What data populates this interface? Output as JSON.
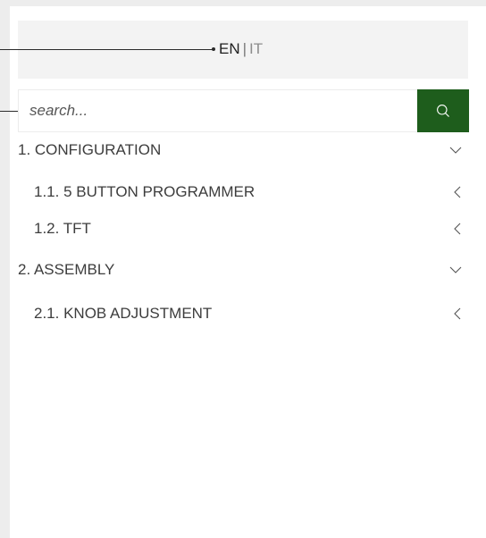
{
  "language": {
    "en_label": "EN",
    "separator": "|",
    "it_label": "IT"
  },
  "search": {
    "placeholder": "search..."
  },
  "menu": {
    "sections": [
      {
        "label": "1. CONFIGURATION",
        "expanded": true,
        "items": [
          {
            "label": "1.1. 5 BUTTON PROGRAMMER"
          },
          {
            "label": "1.2. TFT"
          }
        ]
      },
      {
        "label": "2. ASSEMBLY",
        "expanded": true,
        "items": [
          {
            "label": "2.1. KNOB ADJUSTMENT"
          }
        ]
      }
    ]
  },
  "colors": {
    "search_button": "#1e5d1c",
    "page_background": "#ededed",
    "lang_bar": "#f3f3f3",
    "text": "#3d3d3d"
  },
  "icons": {
    "search_button": "search-icon",
    "expanded_section": "chevron-down-icon",
    "collapsed_item": "chevron-left-icon"
  }
}
